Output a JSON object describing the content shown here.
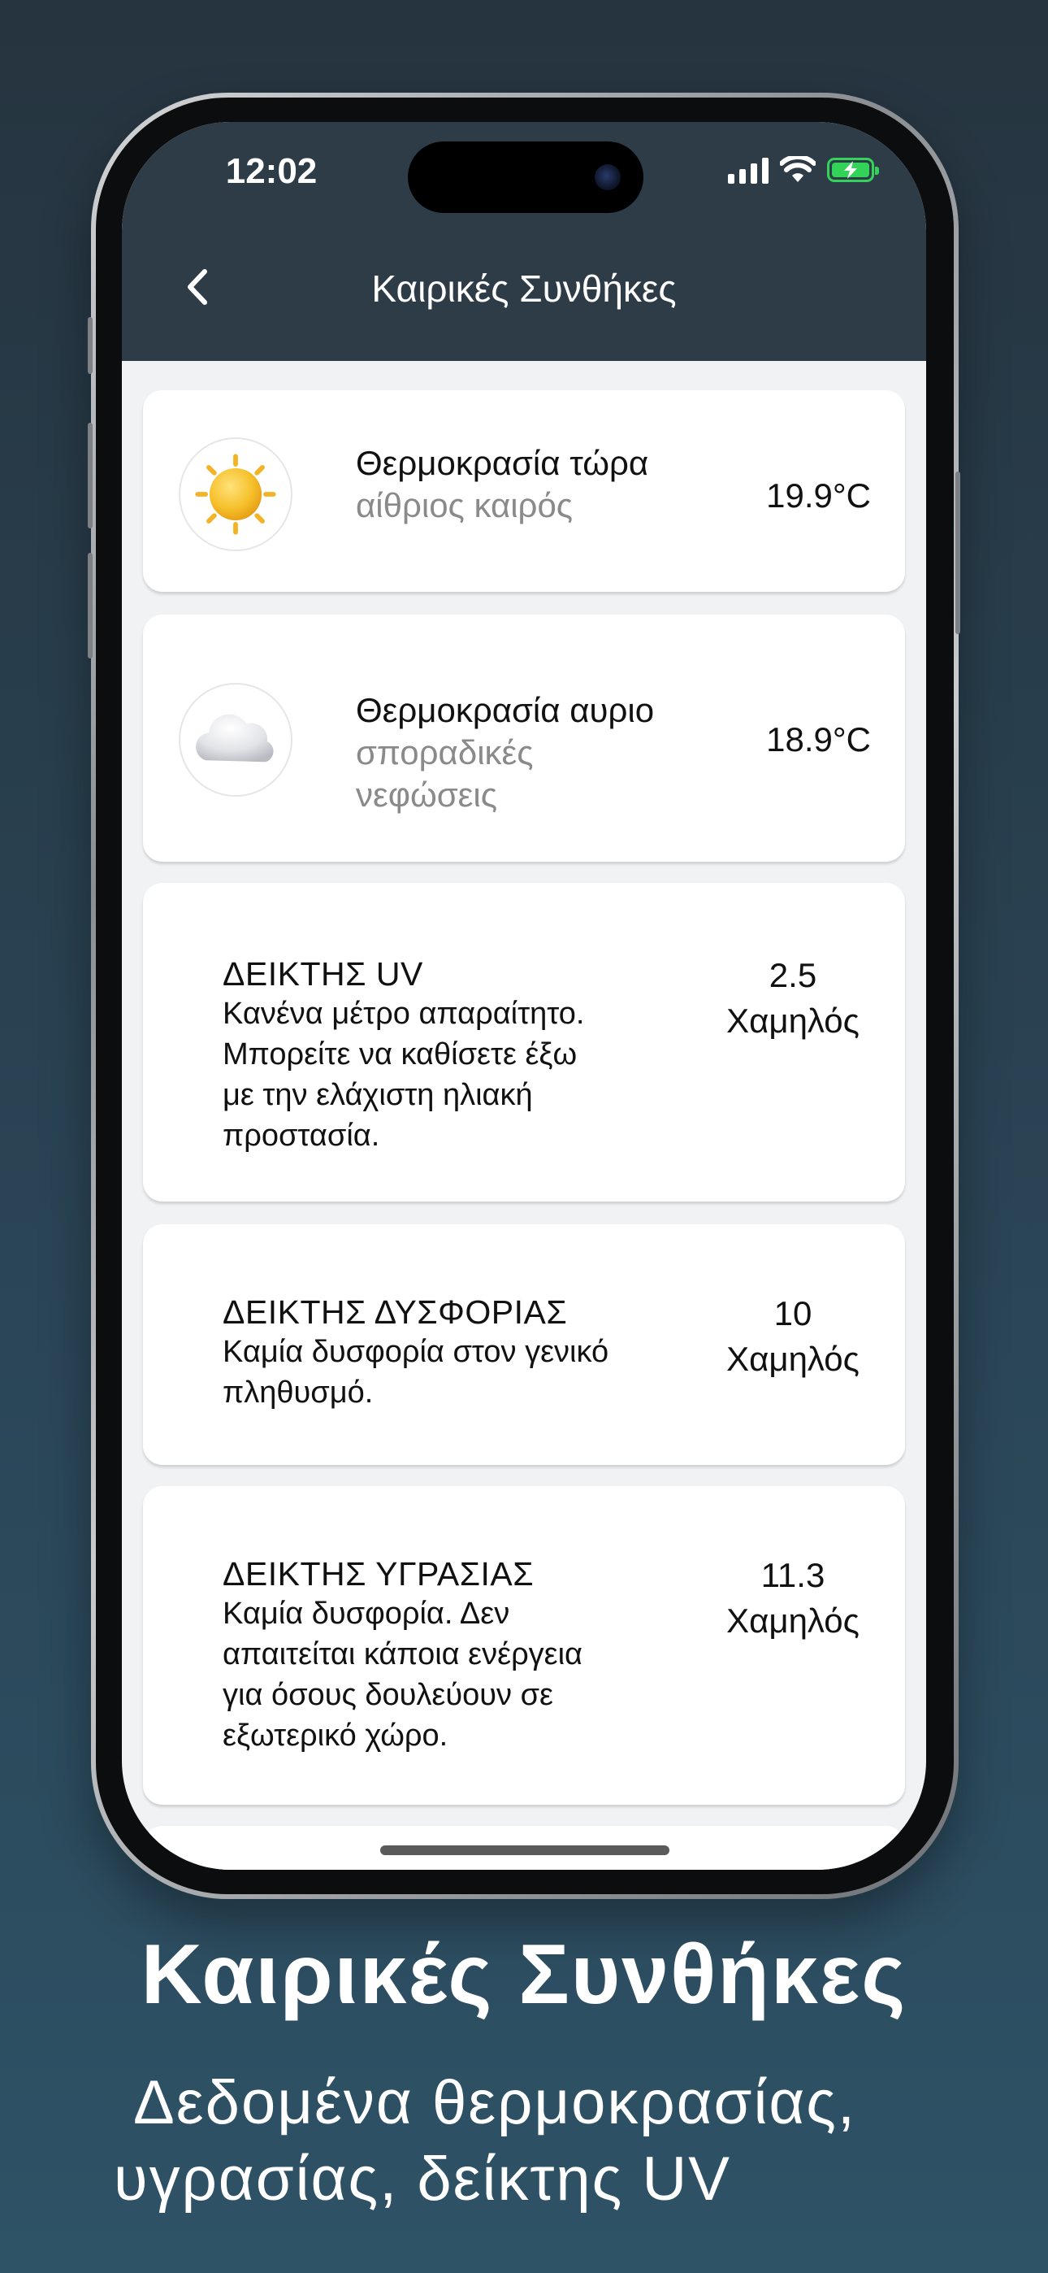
{
  "status_bar": {
    "time": "12:02"
  },
  "header": {
    "title": "Καιρικές Συνθήκες"
  },
  "cards": {
    "now": {
      "title": "Θερμοκρασία τώρα",
      "subtitle": "αίθριος καιρός",
      "value": "19.9°C",
      "icon": "sun-icon"
    },
    "tomorrow": {
      "title": "Θερμοκρασία αυριο",
      "subtitle_line1": "σποραδικές",
      "subtitle_line2": "νεφώσεις",
      "value": "18.9°C",
      "icon": "cloud-icon"
    },
    "uv": {
      "title": "ΔΕΙΚΤΗΣ UV",
      "desc": [
        "Κανένα μέτρο απαραίτητο.",
        "Μπορείτε να καθίσετε έξω",
        "με την ελάχιστη ηλιακή",
        "προστασία."
      ],
      "value": "2.5",
      "level": "Χαμηλός"
    },
    "discomfort": {
      "title": "ΔΕΙΚΤΗΣ ΔΥΣΦΟΡΙΑΣ",
      "desc": [
        "Καμία δυσφορία στον γενικό",
        "πληθυσμό."
      ],
      "value": "10",
      "level": "Χαμηλός"
    },
    "humidity": {
      "title": "ΔΕΙΚΤΗΣ ΥΓΡΑΣΙΑΣ",
      "desc": [
        "Καμία δυσφορία. Δεν",
        "απαιτείται κάποια ενέργεια",
        "για όσους δουλεύουν σε",
        "εξωτερικό χώρο."
      ],
      "value": "11.3",
      "level": "Χαμηλός"
    }
  },
  "promo": {
    "title": "Καιρικές Συνθήκες",
    "subtitle_line1": "Δεδομένα θερμοκρασίας,",
    "subtitle_line2": "υγρασίας, δείκτης UV"
  },
  "colors": {
    "header_bg": "#2e3c48",
    "screen_bg": "#f1f2f4",
    "battery": "#33d35a"
  }
}
